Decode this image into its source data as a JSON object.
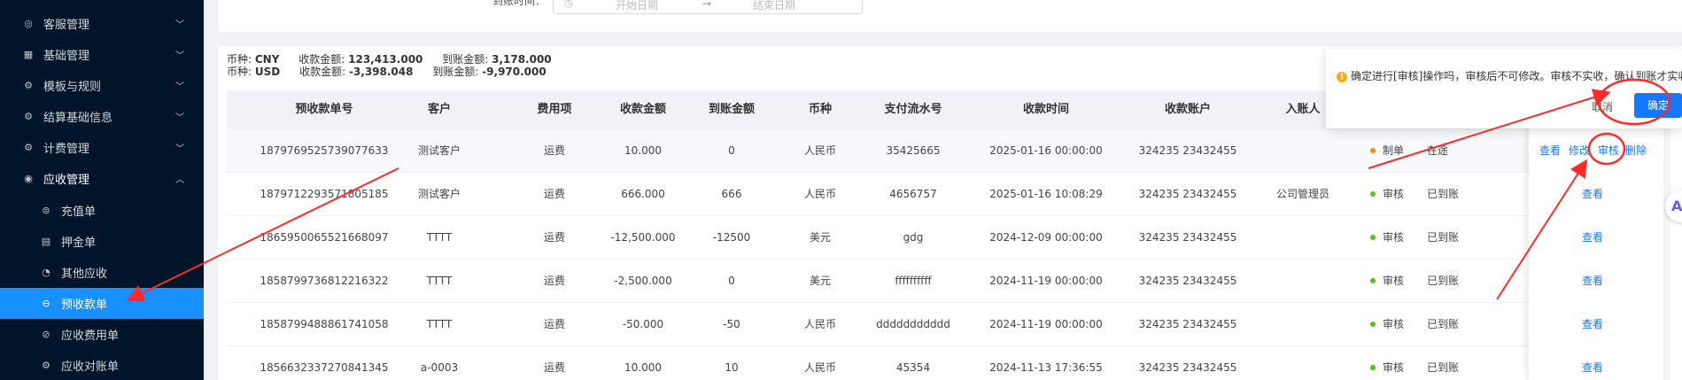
{
  "sidebar": {
    "items": [
      {
        "label": "客服管理",
        "icon": "service-icon",
        "expanded": false
      },
      {
        "label": "基础管理",
        "icon": "grid-icon",
        "expanded": false
      },
      {
        "label": "模板与规则",
        "icon": "gear-icon",
        "expanded": false
      },
      {
        "label": "结算基础信息",
        "icon": "gear-icon",
        "expanded": false
      },
      {
        "label": "计费管理",
        "icon": "gear-icon",
        "expanded": false
      },
      {
        "label": "应收管理",
        "icon": "circle-icon",
        "expanded": true
      }
    ],
    "subitems": [
      {
        "label": "充值单",
        "icon": "recharge-icon",
        "active": false
      },
      {
        "label": "押金单",
        "icon": "document-icon",
        "active": false
      },
      {
        "label": "其他应收",
        "icon": "pie-icon",
        "active": false
      },
      {
        "label": "预收款单",
        "icon": "currency-icon",
        "active": true
      },
      {
        "label": "应收费用单",
        "icon": "check-circle-icon",
        "active": false
      },
      {
        "label": "应收对账单",
        "icon": "gear-icon",
        "active": false
      }
    ]
  },
  "filter": {
    "arrival_time_label": "到账时间：",
    "start_placeholder": "开始日期",
    "end_placeholder": "结束日期",
    "separator": "→"
  },
  "summary": {
    "line1": {
      "currency_label": "币种:",
      "currency": "CNY",
      "received_label": "收款金额:",
      "received": "123,413.000",
      "arrived_label": "到账金额:",
      "arrived": "3,178.000"
    },
    "line2": {
      "currency_label": "币种:",
      "currency": "USD",
      "received_label": "收款金额:",
      "received": "-3,398.048",
      "arrived_label": "到账金额:",
      "arrived": "-9,970.000"
    }
  },
  "table": {
    "columns": [
      "预收款单号",
      "客户",
      "费用项",
      "收款金额",
      "到账金额",
      "币种",
      "支付流水号",
      "收款时间",
      "收款账户",
      "入账人"
    ],
    "rows": [
      {
        "no": "1879769525739077633",
        "customer": "测试客户",
        "fee": "运费",
        "received": "10.000",
        "arrived": "0",
        "currency": "人民币",
        "serial": "35425665",
        "time": "2025-01-16 00:00:00",
        "account": "324235 23432455",
        "booker": "",
        "status": "制单",
        "status_color": "#fa8c16",
        "state": "在途",
        "actions": [
          "查看",
          "修改",
          "审核",
          "删除"
        ]
      },
      {
        "no": "1879712293571805185",
        "customer": "测试客户",
        "fee": "运费",
        "received": "666.000",
        "arrived": "666",
        "currency": "人民币",
        "serial": "4656757",
        "time": "2025-01-16 10:08:29",
        "account": "324235 23432455",
        "booker": "公司管理员",
        "status": "审核",
        "status_color": "#52c41a",
        "state": "已到账",
        "actions": [
          "查看"
        ]
      },
      {
        "no": "1865950065521668097",
        "customer": "TTTT",
        "fee": "运费",
        "received": "-12,500.000",
        "arrived": "-12500",
        "currency": "美元",
        "serial": "gdg",
        "time": "2024-12-09 00:00:00",
        "account": "324235 23432455",
        "booker": "",
        "status": "审核",
        "status_color": "#52c41a",
        "state": "已到账",
        "actions": [
          "查看"
        ]
      },
      {
        "no": "1858799736812216322",
        "customer": "TTTT",
        "fee": "运费",
        "received": "-2,500.000",
        "arrived": "0",
        "currency": "美元",
        "serial": "ffffffffff",
        "time": "2024-11-19 00:00:00",
        "account": "324235 23432455",
        "booker": "",
        "status": "审核",
        "status_color": "#52c41a",
        "state": "已到账",
        "actions": [
          "查看"
        ]
      },
      {
        "no": "1858799488861741058",
        "customer": "TTTT",
        "fee": "运费",
        "received": "-50.000",
        "arrived": "-50",
        "currency": "人民币",
        "serial": "ddddddddddd",
        "time": "2024-11-19 00:00:00",
        "account": "324235 23432455",
        "booker": "",
        "status": "审核",
        "status_color": "#52c41a",
        "state": "已到账",
        "actions": [
          "查看"
        ]
      },
      {
        "no": "1856632337270841345",
        "customer": "a-0003",
        "fee": "运费",
        "received": "10.000",
        "arrived": "10",
        "currency": "人民币",
        "serial": "45354",
        "time": "2024-11-13 17:36:55",
        "account": "324235 23432455",
        "booker": "",
        "status": "审核",
        "status_color": "#52c41a",
        "state": "已到账",
        "actions": [
          "查看"
        ]
      }
    ]
  },
  "popconfirm": {
    "message": "确定进行[审核]操作吗，审核后不可修改。审核不实收，确认到账才实收",
    "cancel": "取消",
    "ok": "确定"
  },
  "colors": {
    "sidebar_bg": "#001529",
    "active_bg": "#1890ff",
    "link": "#1677ff",
    "annotation": "#ff2a2a"
  }
}
